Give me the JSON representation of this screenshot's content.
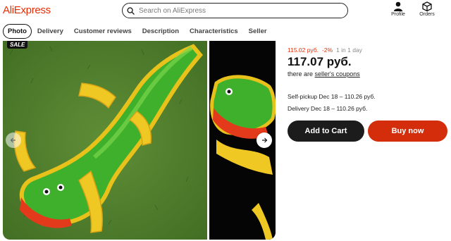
{
  "header": {
    "logo": "AliExpress",
    "search_placeholder": "Search on AliExpress",
    "profile_label": "Profile",
    "orders_label": "Orders"
  },
  "tabs": [
    {
      "label": "Photo",
      "active": true
    },
    {
      "label": "Delivery"
    },
    {
      "label": "Customer reviews"
    },
    {
      "label": "Description"
    },
    {
      "label": "Characteristics"
    },
    {
      "label": "Seller"
    }
  ],
  "gallery": {
    "badge": "SALE"
  },
  "product": {
    "old_price": "115.02 руб.",
    "discount": "-2%",
    "sold": "1 in 1 day",
    "price": "117.07 руб.",
    "coupon_prefix": "there are",
    "coupon_link": "seller's coupons",
    "self_pickup": "Self-pickup Dec 18 – 110.26 руб.",
    "delivery": "Delivery Dec 18 – 110.26 руб."
  },
  "actions": {
    "add_to_cart": "Add to Cart",
    "buy_now": "Buy now"
  },
  "colors": {
    "brand": "#e62e04",
    "buy_button": "#d42d0b",
    "cart_button": "#1c1c1c"
  }
}
